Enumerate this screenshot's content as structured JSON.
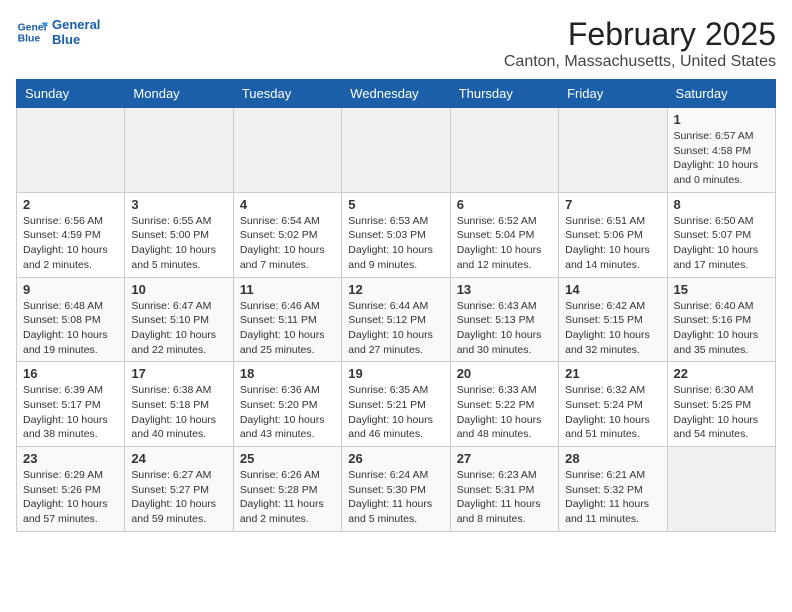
{
  "header": {
    "logo_line1": "General",
    "logo_line2": "Blue",
    "title": "February 2025",
    "subtitle": "Canton, Massachusetts, United States"
  },
  "weekdays": [
    "Sunday",
    "Monday",
    "Tuesday",
    "Wednesday",
    "Thursday",
    "Friday",
    "Saturday"
  ],
  "weeks": [
    [
      {
        "day": "",
        "info": ""
      },
      {
        "day": "",
        "info": ""
      },
      {
        "day": "",
        "info": ""
      },
      {
        "day": "",
        "info": ""
      },
      {
        "day": "",
        "info": ""
      },
      {
        "day": "",
        "info": ""
      },
      {
        "day": "1",
        "info": "Sunrise: 6:57 AM\nSunset: 4:58 PM\nDaylight: 10 hours\nand 0 minutes."
      }
    ],
    [
      {
        "day": "2",
        "info": "Sunrise: 6:56 AM\nSunset: 4:59 PM\nDaylight: 10 hours\nand 2 minutes."
      },
      {
        "day": "3",
        "info": "Sunrise: 6:55 AM\nSunset: 5:00 PM\nDaylight: 10 hours\nand 5 minutes."
      },
      {
        "day": "4",
        "info": "Sunrise: 6:54 AM\nSunset: 5:02 PM\nDaylight: 10 hours\nand 7 minutes."
      },
      {
        "day": "5",
        "info": "Sunrise: 6:53 AM\nSunset: 5:03 PM\nDaylight: 10 hours\nand 9 minutes."
      },
      {
        "day": "6",
        "info": "Sunrise: 6:52 AM\nSunset: 5:04 PM\nDaylight: 10 hours\nand 12 minutes."
      },
      {
        "day": "7",
        "info": "Sunrise: 6:51 AM\nSunset: 5:06 PM\nDaylight: 10 hours\nand 14 minutes."
      },
      {
        "day": "8",
        "info": "Sunrise: 6:50 AM\nSunset: 5:07 PM\nDaylight: 10 hours\nand 17 minutes."
      }
    ],
    [
      {
        "day": "9",
        "info": "Sunrise: 6:48 AM\nSunset: 5:08 PM\nDaylight: 10 hours\nand 19 minutes."
      },
      {
        "day": "10",
        "info": "Sunrise: 6:47 AM\nSunset: 5:10 PM\nDaylight: 10 hours\nand 22 minutes."
      },
      {
        "day": "11",
        "info": "Sunrise: 6:46 AM\nSunset: 5:11 PM\nDaylight: 10 hours\nand 25 minutes."
      },
      {
        "day": "12",
        "info": "Sunrise: 6:44 AM\nSunset: 5:12 PM\nDaylight: 10 hours\nand 27 minutes."
      },
      {
        "day": "13",
        "info": "Sunrise: 6:43 AM\nSunset: 5:13 PM\nDaylight: 10 hours\nand 30 minutes."
      },
      {
        "day": "14",
        "info": "Sunrise: 6:42 AM\nSunset: 5:15 PM\nDaylight: 10 hours\nand 32 minutes."
      },
      {
        "day": "15",
        "info": "Sunrise: 6:40 AM\nSunset: 5:16 PM\nDaylight: 10 hours\nand 35 minutes."
      }
    ],
    [
      {
        "day": "16",
        "info": "Sunrise: 6:39 AM\nSunset: 5:17 PM\nDaylight: 10 hours\nand 38 minutes."
      },
      {
        "day": "17",
        "info": "Sunrise: 6:38 AM\nSunset: 5:18 PM\nDaylight: 10 hours\nand 40 minutes."
      },
      {
        "day": "18",
        "info": "Sunrise: 6:36 AM\nSunset: 5:20 PM\nDaylight: 10 hours\nand 43 minutes."
      },
      {
        "day": "19",
        "info": "Sunrise: 6:35 AM\nSunset: 5:21 PM\nDaylight: 10 hours\nand 46 minutes."
      },
      {
        "day": "20",
        "info": "Sunrise: 6:33 AM\nSunset: 5:22 PM\nDaylight: 10 hours\nand 48 minutes."
      },
      {
        "day": "21",
        "info": "Sunrise: 6:32 AM\nSunset: 5:24 PM\nDaylight: 10 hours\nand 51 minutes."
      },
      {
        "day": "22",
        "info": "Sunrise: 6:30 AM\nSunset: 5:25 PM\nDaylight: 10 hours\nand 54 minutes."
      }
    ],
    [
      {
        "day": "23",
        "info": "Sunrise: 6:29 AM\nSunset: 5:26 PM\nDaylight: 10 hours\nand 57 minutes."
      },
      {
        "day": "24",
        "info": "Sunrise: 6:27 AM\nSunset: 5:27 PM\nDaylight: 10 hours\nand 59 minutes."
      },
      {
        "day": "25",
        "info": "Sunrise: 6:26 AM\nSunset: 5:28 PM\nDaylight: 11 hours\nand 2 minutes."
      },
      {
        "day": "26",
        "info": "Sunrise: 6:24 AM\nSunset: 5:30 PM\nDaylight: 11 hours\nand 5 minutes."
      },
      {
        "day": "27",
        "info": "Sunrise: 6:23 AM\nSunset: 5:31 PM\nDaylight: 11 hours\nand 8 minutes."
      },
      {
        "day": "28",
        "info": "Sunrise: 6:21 AM\nSunset: 5:32 PM\nDaylight: 11 hours\nand 11 minutes."
      },
      {
        "day": "",
        "info": ""
      }
    ]
  ]
}
